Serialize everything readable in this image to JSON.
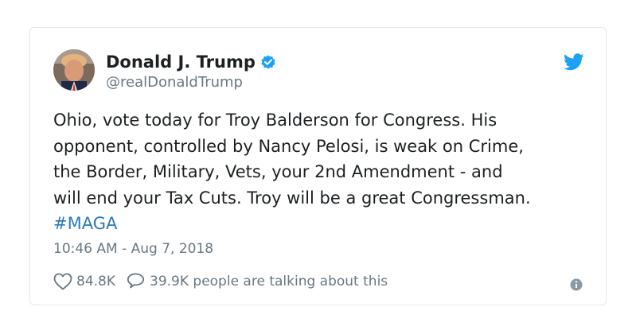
{
  "author": {
    "display_name": "Donald J. Trump",
    "handle": "@realDonaldTrump",
    "verified": true,
    "avatar_icon": "profile-photo"
  },
  "icons": {
    "brand": "twitter-bird-icon",
    "like": "heart-icon",
    "reply": "speech-bubble-icon",
    "info": "info-icon"
  },
  "tweet": {
    "lines": [
      "Ohio, vote today for Troy Balderson for Congress. His",
      "opponent, controlled by Nancy Pelosi, is weak on Crime,",
      "the Border, Military, Vets, your 2nd Amendment - and",
      "will end your Tax Cuts. Troy will be a great Congressman."
    ],
    "hashtag": "#MAGA",
    "timestamp": "10:46 AM - Aug 7, 2018"
  },
  "stats": {
    "likes": "84.8K",
    "talking": "39.9K people are talking about this"
  },
  "colors": {
    "brand_blue": "#1da1f2",
    "link_blue": "#2b7bb9",
    "muted_gray": "#697882",
    "text": "#1c2022",
    "border": "#e1e8ed"
  }
}
